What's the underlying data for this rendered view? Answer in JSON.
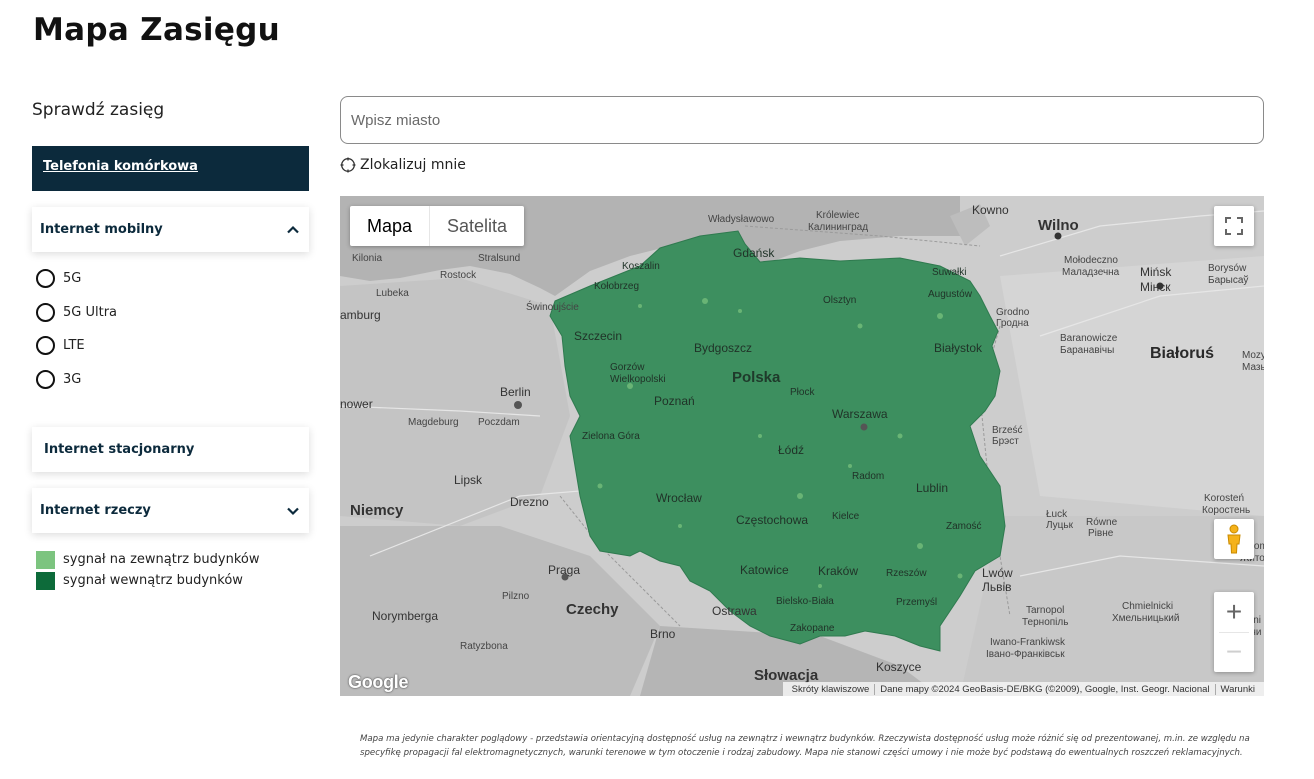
{
  "page": {
    "title": "Mapa Zasięgu"
  },
  "sidebar": {
    "check_label": "Sprawdź zasięg",
    "tab_mobile_phone": "Telefonia komórkowa",
    "mobile_internet": {
      "label": "Internet mobilny",
      "expanded": true,
      "options": [
        "5G",
        "5G Ultra",
        "LTE",
        "3G"
      ]
    },
    "fixed_internet": {
      "label": "Internet stacjonarny"
    },
    "iot": {
      "label": "Internet rzeczy",
      "expanded": false
    },
    "legend": [
      {
        "label": "sygnał na zewnątrz budynków",
        "color": "#7cc47f"
      },
      {
        "label": "sygnał wewnątrz budynków",
        "color": "#0d6b3a"
      }
    ]
  },
  "search": {
    "placeholder": "Wpisz miasto",
    "value": ""
  },
  "locate": {
    "label": "Zlokalizuj mnie"
  },
  "map": {
    "type_buttons": {
      "map": "Mapa",
      "satellite": "Satelita",
      "selected": "map"
    },
    "coverage_color": "#3d8f5f",
    "country_label": "Polska",
    "labels": {
      "wladyslawowo": "Władysławowo",
      "krolewiec": "Królewiec",
      "kaliningrad": "Калининград",
      "kowno": "Kowno",
      "wilno": "Wilno",
      "gdansk": "Gdańsk",
      "kilonia": "Kilonia",
      "stralsund": "Stralsund",
      "rostock": "Rostock",
      "koszalin": "Koszalin",
      "kolobrzeg": "Kołobrzeg",
      "olsztyn": "Olsztyn",
      "suwalki": "Suwałki",
      "augustow": "Augustów",
      "molodeczno": "Mołodeczno",
      "molodeczno_ru": "Маладзечна",
      "minsk": "Mińsk",
      "minsk_ru": "Мінск",
      "borysow": "Borysów",
      "borysow_ru": "Барысаў",
      "lubeka": "Lubeka",
      "swinoujscie": "Świnoujście",
      "hamburg": "amburg",
      "szczecin": "Szczecin",
      "bydgoszcz": "Bydgoszcz",
      "bialystok": "Białystok",
      "grodno": "Grodno",
      "grodno_ru": "Гродна",
      "baranowicze": "Baranowicze",
      "baranowicze_ru": "Баранавічы",
      "bialorus": "Białoruś",
      "gorzow": "Gorzów Wielkopolski",
      "berlin": "Berlin",
      "plock": "Płock",
      "hanower": "nower",
      "poznan": "Poznań",
      "warszawa": "Warszawa",
      "magdeburg": "Magdeburg",
      "poczdam": "Poczdam",
      "zielona_gora": "Zielona Góra",
      "lodz": "Łódź",
      "brzesc": "Brześć",
      "brzesc_ru": "Брэст",
      "lipsk": "Lipsk",
      "radom": "Radom",
      "lublin": "Lublin",
      "drezno": "Drezno",
      "wroclaw": "Wrocław",
      "niemcy": "Niemcy",
      "czestochowa": "Częstochowa",
      "kielce": "Kielce",
      "zamosc": "Zamość",
      "luck": "Łuck",
      "luck_ua": "Луцьк",
      "rowne": "Równe",
      "rowne_ua": "Рівне",
      "korosten": "Korosteń",
      "korosten_ua": "Коростень",
      "praga": "Praga",
      "katowice": "Katowice",
      "krakow": "Kraków",
      "rzeszow": "Rzeszów",
      "lwow": "Lwów",
      "lwow_ua": "Львів",
      "zytomierz": "Żytom",
      "zytomierz_ua": "Житомир",
      "czechy": "Czechy",
      "pilzno": "Pilzno",
      "ostrawa": "Ostrawa",
      "bielsko": "Bielsko-Biała",
      "przemysl": "Przemyśl",
      "tarnopol": "Tarnopol",
      "tarnopol_ua": "Тернопіль",
      "chmielnicki": "Chmielnicki",
      "chmielnicki_ua": "Хмельницький",
      "winnica": "Winni",
      "winnica_ua": "Вінни",
      "norymberga": "Norymberga",
      "brno": "Brno",
      "zakopane": "Zakopane",
      "iwano": "Iwano-Frankiwsk",
      "iwano_ua": "Івано-Франківськ",
      "ratyzbona": "Ratyzbona",
      "slowacja": "Słowacja",
      "koszyce": "Koszyce",
      "moz": "Mozyrz",
      "moz_ru": "Мазыр"
    },
    "logo_text": "Google",
    "attribution": [
      "Skróty klawiszowe",
      "Dane mapy ©2024 GeoBasis-DE/BKG (©2009), Google, Inst. Geogr. Nacional",
      "Warunki"
    ]
  },
  "disclaimer": "Mapa ma jedynie charakter poglądowy - przedstawia orientacyjną dostępność usług na zewnątrz i wewnątrz budynków. Rzeczywista dostępność usług może różnić się od prezentowanej, m.in. ze względu na specyfikę propagacji fal elektromagnetycznych, warunki terenowe w tym otoczenie i rodzaj zabudowy. Mapa nie stanowi części umowy i nie może być podstawą do ewentualnych roszczeń reklamacyjnych."
}
